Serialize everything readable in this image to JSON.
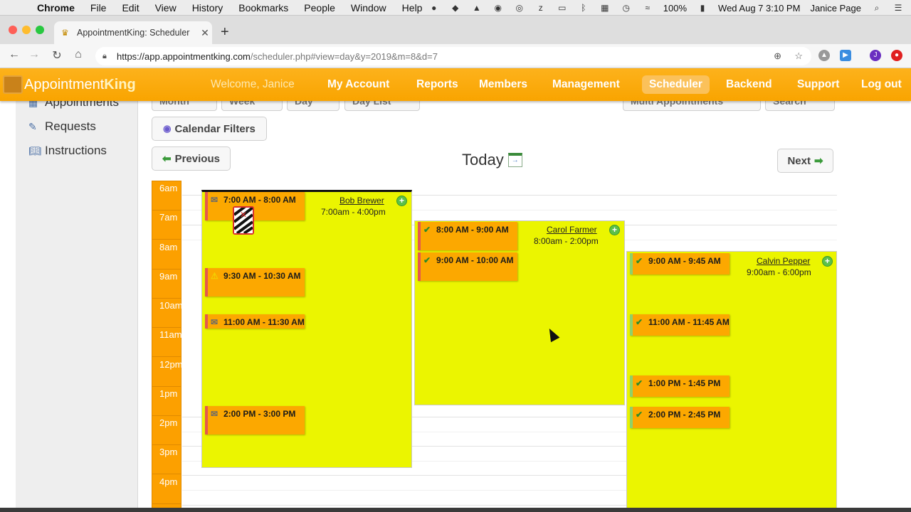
{
  "menubar": {
    "app": "Chrome",
    "items": [
      "File",
      "Edit",
      "View",
      "History",
      "Bookmarks",
      "People",
      "Window",
      "Help"
    ],
    "battery": "100%",
    "datetime": "Wed Aug 7  3:10 PM",
    "user": "Janice Page"
  },
  "tab": {
    "title": "AppointmentKing: Scheduler"
  },
  "address": {
    "host": "https://app.appointmentking.com",
    "path": "/scheduler.php#view=day&y=2019&m=8&d=7"
  },
  "header": {
    "logo_appointment": "Appointment",
    "logo_king": "King",
    "welcome": "Welcome, Janice",
    "nav": [
      "My Account",
      "Reports",
      "Members",
      "Management",
      "Scheduler",
      "Backend",
      "Support",
      "Log out"
    ],
    "active": "Scheduler"
  },
  "sidebar": {
    "items": [
      {
        "label": "Appointments",
        "icon": "calendar-icon"
      },
      {
        "label": "Requests",
        "icon": "pin-icon"
      },
      {
        "label": "Instructions",
        "icon": "book-icon"
      }
    ]
  },
  "view_tabs": [
    "Month",
    "Week",
    "Day",
    "Day List"
  ],
  "toolbar": {
    "multi": "Multi Appointments",
    "search": "Search",
    "filters": "Calendar Filters",
    "previous": "Previous",
    "next": "Next",
    "today": "Today"
  },
  "hours": [
    "6am",
    "7am",
    "8am",
    "9am",
    "10am",
    "11am",
    "12pm",
    "1pm",
    "2pm",
    "3pm",
    "4pm"
  ],
  "staff": [
    {
      "name": "Bob Brewer",
      "hours": "7:00am - 4:00pm",
      "appointments": [
        {
          "time": "7:00 AM - 8:00 AM",
          "status": "message-icon"
        },
        {
          "time": "9:30 AM - 10:30 AM",
          "status": "warning-icon"
        },
        {
          "time": "11:00 AM - 11:30 AM",
          "status": "message-icon"
        },
        {
          "time": "2:00 PM - 3:00 PM",
          "status": "message-icon"
        }
      ]
    },
    {
      "name": "Carol Farmer",
      "hours": "8:00am - 2:00pm",
      "appointments": [
        {
          "time": "8:00 AM - 9:00 AM",
          "status": "check-icon"
        },
        {
          "time": "9:00 AM - 10:00 AM",
          "status": "check-icon"
        }
      ]
    },
    {
      "name": "Calvin Pepper",
      "hours": "9:00am - 6:00pm",
      "appointments": [
        {
          "time": "9:00 AM - 9:45 AM",
          "status": "check-icon"
        },
        {
          "time": "11:00 AM - 11:45 AM",
          "status": "check-icon"
        },
        {
          "time": "1:00 PM - 1:45 PM",
          "status": "check-icon"
        },
        {
          "time": "2:00 PM - 2:45 PM",
          "status": "check-icon"
        }
      ]
    }
  ],
  "colors": {
    "header": "#fca800",
    "column": "#ebf500",
    "appointment": "#fca800",
    "accent_red": "#e4584e"
  }
}
